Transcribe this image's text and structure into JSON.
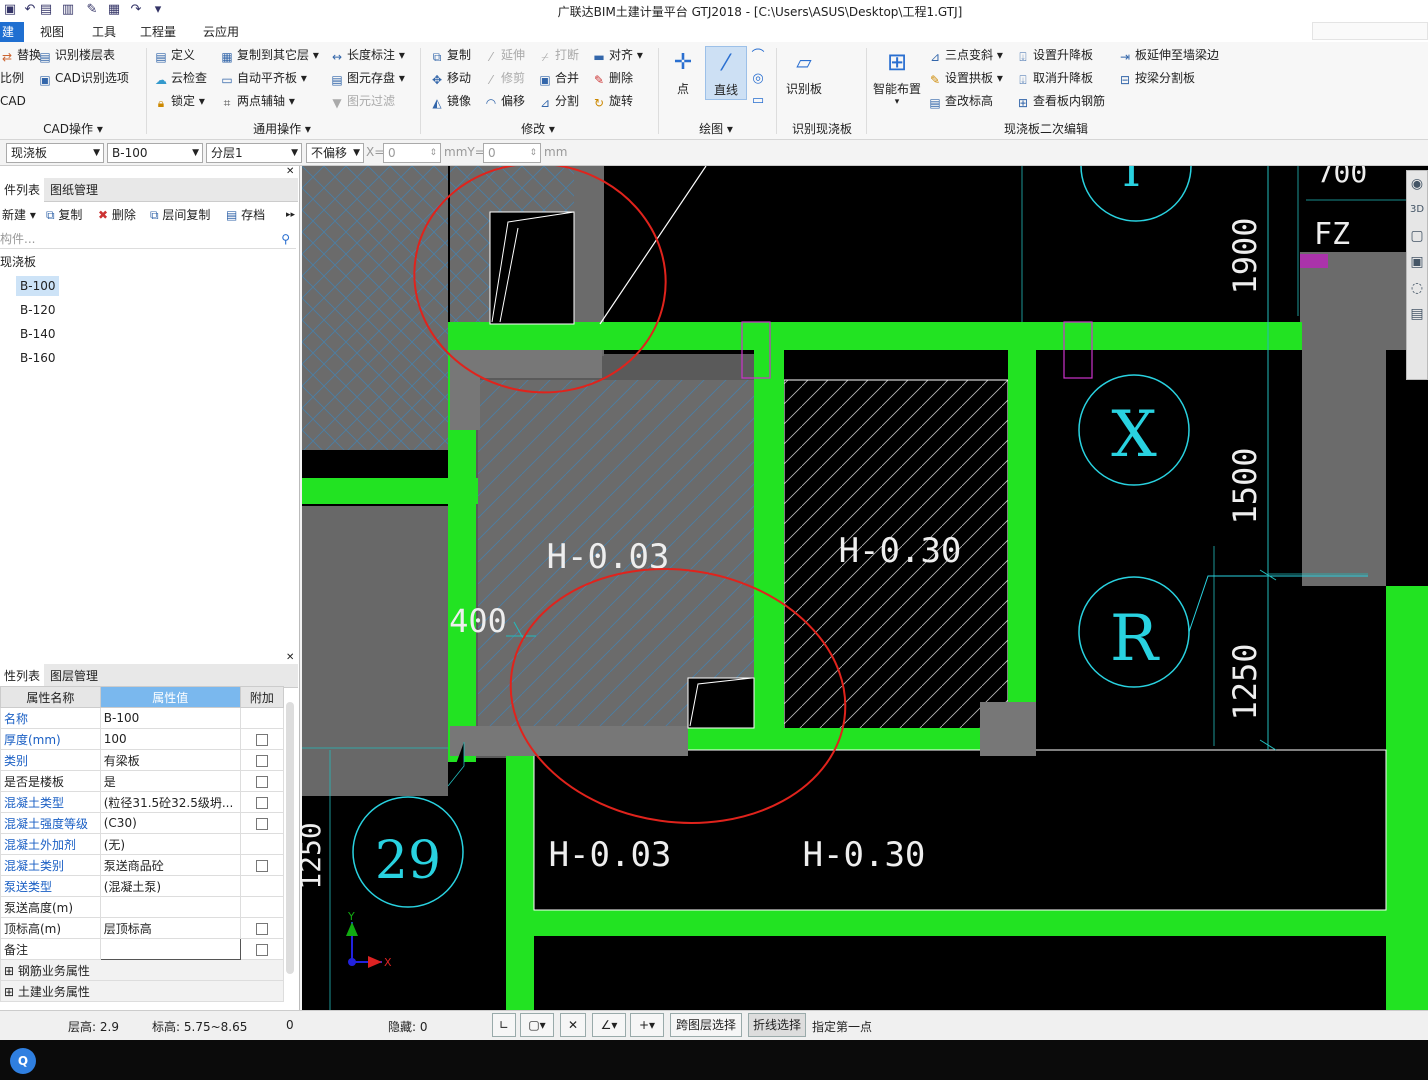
{
  "window": {
    "title": "广联达BIM土建计量平台 GTJ2018 - [C:\\Users\\ASUS\\Desktop\\工程1.GTJ]"
  },
  "menu": [
    "建模",
    "视图",
    "工具",
    "工程量",
    "云应用"
  ],
  "ribbon": {
    "cad_ops": {
      "items": [
        "替换",
        "识别楼层表",
        "比例",
        "CAD识别选项",
        "CAD"
      ],
      "label": "CAD操作"
    },
    "general_ops": {
      "items": [
        "定义",
        "复制到其它层",
        "长度标注",
        "云检查",
        "自动平齐板",
        "图元存盘",
        "锁定",
        "两点辅轴",
        "图元过滤"
      ],
      "label": "通用操作"
    },
    "modify": {
      "items": [
        "复制",
        "延伸",
        "打断",
        "对齐",
        "移动",
        "修剪",
        "合并",
        "删除",
        "镜像",
        "偏移",
        "分割",
        "旋转"
      ],
      "label": "修改"
    },
    "draw": {
      "items": [
        "点",
        "直线"
      ],
      "label": "绘图"
    },
    "identify": {
      "items": [
        "识别板"
      ],
      "label": "识别现浇板"
    },
    "secondary": {
      "big": "智能布置",
      "items": [
        "三点变斜",
        "设置升降板",
        "板延伸至墙梁边",
        "设置拱板",
        "取消升降板",
        "按梁分割板",
        "查改标高",
        "查看板内钢筋"
      ],
      "label": "现浇板二次编辑"
    }
  },
  "toolbar2": {
    "type": "现浇板",
    "component": "B-100",
    "layer": "分层1",
    "offset": "不偏移",
    "x_label": "X=",
    "x_value": "0",
    "unit1": "mmY=",
    "y_value": "0",
    "unit2": "mm"
  },
  "component_panel": {
    "tabs": [
      "件列表",
      "图纸管理"
    ],
    "buttons": [
      "新建",
      "复制",
      "删除",
      "层间复制",
      "存档"
    ],
    "search_placeholder": "构件...",
    "group": "现浇板",
    "items": [
      "B-100",
      "B-120",
      "B-140",
      "B-160"
    ],
    "selected": "B-100"
  },
  "property_panel": {
    "tabs": [
      "性列表",
      "图层管理"
    ],
    "headers": [
      "属性名称",
      "属性值",
      "附加"
    ],
    "rows": [
      {
        "name": "名称",
        "value": "B-100"
      },
      {
        "name": "厚度(mm)",
        "value": "100"
      },
      {
        "name": "类别",
        "value": "有梁板"
      },
      {
        "name": "是否是楼板",
        "value": "是"
      },
      {
        "name": "混凝土类型",
        "value": "(粒径31.5砼32.5级坍..."
      },
      {
        "name": "混凝土强度等级",
        "value": "(C30)"
      },
      {
        "name": "混凝土外加剂",
        "value": "(无)"
      },
      {
        "name": "混凝土类别",
        "value": "泵送商品砼"
      },
      {
        "name": "泵送类型",
        "value": "(混凝土泵)"
      },
      {
        "name": "泵送高度(m)",
        "value": ""
      },
      {
        "name": "顶标高(m)",
        "value": "层顶标高"
      },
      {
        "name": "备注",
        "value": ""
      },
      {
        "name": "钢筋业务属性",
        "value": ""
      },
      {
        "name": "土建业务属性",
        "value": ""
      }
    ]
  },
  "canvas": {
    "labels": [
      "H-0.03",
      "H-0.30",
      "H-0.03",
      "H-0.30",
      "400",
      "1900",
      "1500",
      "1250",
      "1250",
      "700",
      "FZ"
    ],
    "axis_bubbles": [
      "X",
      "R",
      "29"
    ]
  },
  "statusbar": {
    "floor_height_label": "层高:",
    "floor_height": "2.9",
    "elevation_label": "标高:",
    "elevation": "5.75~8.65",
    "zero": "0",
    "hidden_label": "隐藏:",
    "hidden": "0",
    "cross_layer": "跨图层选择",
    "polyline": "折线选择",
    "prompt": "指定第一点"
  },
  "colors": {
    "accent": "#1f6fd1",
    "green_beam": "#22e322",
    "canvas": "#000000",
    "slab_grey": "#6a6a6a",
    "annotation_red": "#e0231c",
    "axis_cyan": "#29d2e0"
  }
}
